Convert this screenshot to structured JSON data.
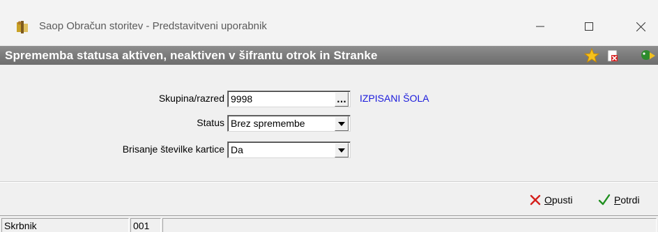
{
  "window": {
    "title": "Saop  Obračun storitev - Predstavitveni uporabnik"
  },
  "dialog": {
    "title": "Sprememba statusa aktiven, neaktiven v šifrantu otrok in Stranke"
  },
  "form": {
    "group": {
      "label": "Skupina/razred",
      "value": "9998",
      "browse_label": "...",
      "description": "IZPISANI ŠOLA"
    },
    "status": {
      "label": "Status",
      "value": "Brez spremembe"
    },
    "card_delete": {
      "label": "Brisanje številke kartice",
      "value": "Da"
    }
  },
  "buttons": {
    "cancel": {
      "label_first": "O",
      "label_rest": "pusti"
    },
    "confirm": {
      "label_first": "P",
      "label_rest": "otrdi"
    }
  },
  "status_bar": {
    "cell1": "Skrbnik",
    "cell2": "001",
    "cell3": ""
  },
  "colors": {
    "header_band": "#7a7a7a",
    "description_text": "#1a1adc",
    "cancel_icon": "#d4201c",
    "confirm_icon": "#1f8f1f"
  },
  "icons": [
    "app-icon",
    "minimize-icon",
    "maximize-icon",
    "close-icon",
    "favorite-star-icon",
    "close-document-icon",
    "exit-icon",
    "dropdown-arrow-icon",
    "cancel-x-icon",
    "confirm-check-icon"
  ]
}
